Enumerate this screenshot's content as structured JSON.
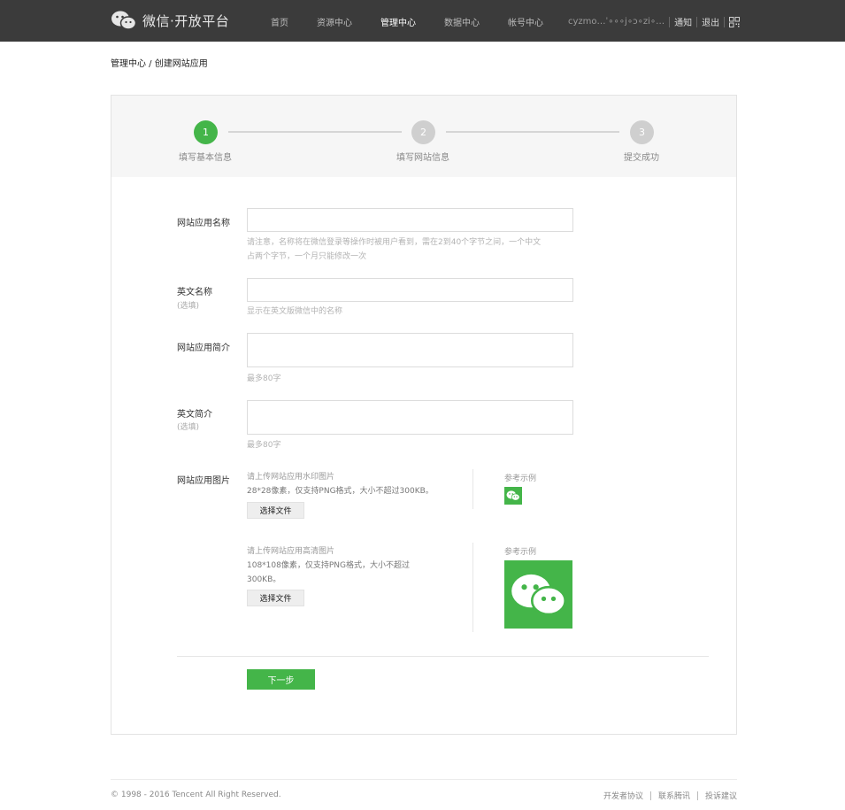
{
  "header": {
    "brand": "微信·开放平台",
    "nav": [
      {
        "label": "首页"
      },
      {
        "label": "资源中心"
      },
      {
        "label": "管理中心",
        "active": true
      },
      {
        "label": "数据中心"
      },
      {
        "label": "帐号中心"
      }
    ],
    "user_name": "cyzmo…ˈ∘∘∘j∘ɔ∘zi∘…",
    "notify": "通知",
    "logout": "退出",
    "qr_icon": "qr-code-icon"
  },
  "breadcrumb": "管理中心 / 创建网站应用",
  "steps": [
    {
      "number": "1",
      "label": "填写基本信息",
      "active": true
    },
    {
      "number": "2",
      "label": "填写网站信息",
      "active": false
    },
    {
      "number": "3",
      "label": "提交成功",
      "active": false
    }
  ],
  "form": {
    "name": {
      "label": "网站应用名称",
      "value": "",
      "hint_line1": "请注意，名称将在微信登录等操作时被用户看到，需在2到40个字节之间，一个中文",
      "hint_line2": "占两个字节，一个月只能修改一次"
    },
    "en_name": {
      "label": "英文名称",
      "optional": "(选填)",
      "value": "",
      "hint": "显示在英文版微信中的名称"
    },
    "intro": {
      "label": "网站应用简介",
      "value": "",
      "hint": "最多80字"
    },
    "en_intro": {
      "label": "英文简介",
      "optional": "(选填)",
      "value": "",
      "hint": "最多80字"
    },
    "images": {
      "label": "网站应用图片",
      "small": {
        "title": "请上传网站应用水印图片",
        "desc": "28*28像素，仅支持PNG格式，大小不超过300KB。",
        "button": "选择文件",
        "example_label": "参考示例"
      },
      "large": {
        "title": "请上传网站应用高清图片",
        "desc_line1": "108*108像素，仅支持PNG格式，大小不超过",
        "desc_line2": "300KB。",
        "button": "选择文件",
        "example_label": "参考示例"
      }
    },
    "next_button": "下一步"
  },
  "footer": {
    "copyright": "© 1998 - 2016 Tencent All Right Reserved.",
    "links": [
      "开发者协议",
      "联系腾讯",
      "投诉建议"
    ]
  },
  "colors": {
    "accent": "#44b549",
    "topbar": "#3b3b3b"
  }
}
